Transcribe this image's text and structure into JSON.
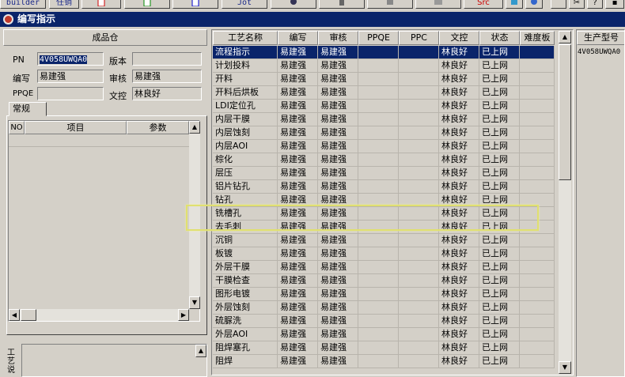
{
  "toolbar": {
    "builder_label": "builder",
    "config_label": "任销",
    "jot_label": "Jot",
    "src_label": "Src"
  },
  "window": {
    "title": "编写指示"
  },
  "left": {
    "header": "成品仓",
    "pn_label": "PN",
    "pn_value": "4V058UWQA0",
    "version_label": "版本",
    "version_value": "",
    "author_label": "编写",
    "author_value": "易建强",
    "reviewer_label": "审核",
    "reviewer_value": "易建强",
    "ppqe_label": "PPQE",
    "ppqe_value": "",
    "doc_control_label": "文控",
    "doc_control_value": "林良好",
    "tab_label": "常规",
    "param_table": {
      "col_no": "NO",
      "col_item": "项目",
      "col_param": "参数"
    },
    "notes_label": "工艺说"
  },
  "grid": {
    "columns": [
      "工艺名称",
      "编写",
      "审核",
      "PPQE",
      "PPC",
      "文控",
      "状态",
      "难度板"
    ],
    "rows": [
      {
        "name": "流程指示",
        "author": "易建强",
        "reviewer": "易建强",
        "ppqe": "",
        "ppc": "",
        "doc": "林良好",
        "status": "已上网",
        "level": ""
      },
      {
        "name": "计划投料",
        "author": "易建强",
        "reviewer": "易建强",
        "ppqe": "",
        "ppc": "",
        "doc": "林良好",
        "status": "已上网",
        "level": ""
      },
      {
        "name": "开料",
        "author": "易建强",
        "reviewer": "易建强",
        "ppqe": "",
        "ppc": "",
        "doc": "林良好",
        "status": "已上网",
        "level": ""
      },
      {
        "name": "开料后烘板",
        "author": "易建强",
        "reviewer": "易建强",
        "ppqe": "",
        "ppc": "",
        "doc": "林良好",
        "status": "已上网",
        "level": ""
      },
      {
        "name": "LDI定位孔",
        "author": "易建强",
        "reviewer": "易建强",
        "ppqe": "",
        "ppc": "",
        "doc": "林良好",
        "status": "已上网",
        "level": ""
      },
      {
        "name": "内层干膜",
        "author": "易建强",
        "reviewer": "易建强",
        "ppqe": "",
        "ppc": "",
        "doc": "林良好",
        "status": "已上网",
        "level": ""
      },
      {
        "name": "内层蚀刻",
        "author": "易建强",
        "reviewer": "易建强",
        "ppqe": "",
        "ppc": "",
        "doc": "林良好",
        "status": "已上网",
        "level": ""
      },
      {
        "name": "内层AOI",
        "author": "易建强",
        "reviewer": "易建强",
        "ppqe": "",
        "ppc": "",
        "doc": "林良好",
        "status": "已上网",
        "level": ""
      },
      {
        "name": "棕化",
        "author": "易建强",
        "reviewer": "易建强",
        "ppqe": "",
        "ppc": "",
        "doc": "林良好",
        "status": "已上网",
        "level": ""
      },
      {
        "name": "层压",
        "author": "易建强",
        "reviewer": "易建强",
        "ppqe": "",
        "ppc": "",
        "doc": "林良好",
        "status": "已上网",
        "level": ""
      },
      {
        "name": "铝片钻孔",
        "author": "易建强",
        "reviewer": "易建强",
        "ppqe": "",
        "ppc": "",
        "doc": "林良好",
        "status": "已上网",
        "level": ""
      },
      {
        "name": "钻孔",
        "author": "易建强",
        "reviewer": "易建强",
        "ppqe": "",
        "ppc": "",
        "doc": "林良好",
        "status": "已上网",
        "level": ""
      },
      {
        "name": "铣槽孔",
        "author": "易建强",
        "reviewer": "易建强",
        "ppqe": "",
        "ppc": "",
        "doc": "林良好",
        "status": "已上网",
        "level": ""
      },
      {
        "name": "去毛刺",
        "author": "易建强",
        "reviewer": "易建强",
        "ppqe": "",
        "ppc": "",
        "doc": "林良好",
        "status": "已上网",
        "level": ""
      },
      {
        "name": "沉铜",
        "author": "易建强",
        "reviewer": "易建强",
        "ppqe": "",
        "ppc": "",
        "doc": "林良好",
        "status": "已上网",
        "level": ""
      },
      {
        "name": "板镀",
        "author": "易建强",
        "reviewer": "易建强",
        "ppqe": "",
        "ppc": "",
        "doc": "林良好",
        "status": "已上网",
        "level": ""
      },
      {
        "name": "外层干膜",
        "author": "易建强",
        "reviewer": "易建强",
        "ppqe": "",
        "ppc": "",
        "doc": "林良好",
        "status": "已上网",
        "level": ""
      },
      {
        "name": "干膜检查",
        "author": "易建强",
        "reviewer": "易建强",
        "ppqe": "",
        "ppc": "",
        "doc": "林良好",
        "status": "已上网",
        "level": ""
      },
      {
        "name": "图形电镀",
        "author": "易建强",
        "reviewer": "易建强",
        "ppqe": "",
        "ppc": "",
        "doc": "林良好",
        "status": "已上网",
        "level": ""
      },
      {
        "name": "外层蚀刻",
        "author": "易建强",
        "reviewer": "易建强",
        "ppqe": "",
        "ppc": "",
        "doc": "林良好",
        "status": "已上网",
        "level": ""
      },
      {
        "name": "硫脲洗",
        "author": "易建强",
        "reviewer": "易建强",
        "ppqe": "",
        "ppc": "",
        "doc": "林良好",
        "status": "已上网",
        "level": ""
      },
      {
        "name": "外层AOI",
        "author": "易建强",
        "reviewer": "易建强",
        "ppqe": "",
        "ppc": "",
        "doc": "林良好",
        "status": "已上网",
        "level": ""
      },
      {
        "name": "阻焊塞孔",
        "author": "易建强",
        "reviewer": "易建强",
        "ppqe": "",
        "ppc": "",
        "doc": "林良好",
        "status": "已上网",
        "level": ""
      },
      {
        "name": "阻焊",
        "author": "易建强",
        "reviewer": "易建强",
        "ppqe": "",
        "ppc": "",
        "doc": "林良好",
        "status": "已上网",
        "level": ""
      }
    ],
    "selected_row": 0
  },
  "right": {
    "header": "生产型号",
    "value": "4V058UWQA0"
  },
  "colors": {
    "selection": "#0a246a",
    "window_bg": "#d4d0c8",
    "highlight": "#e0e070"
  }
}
